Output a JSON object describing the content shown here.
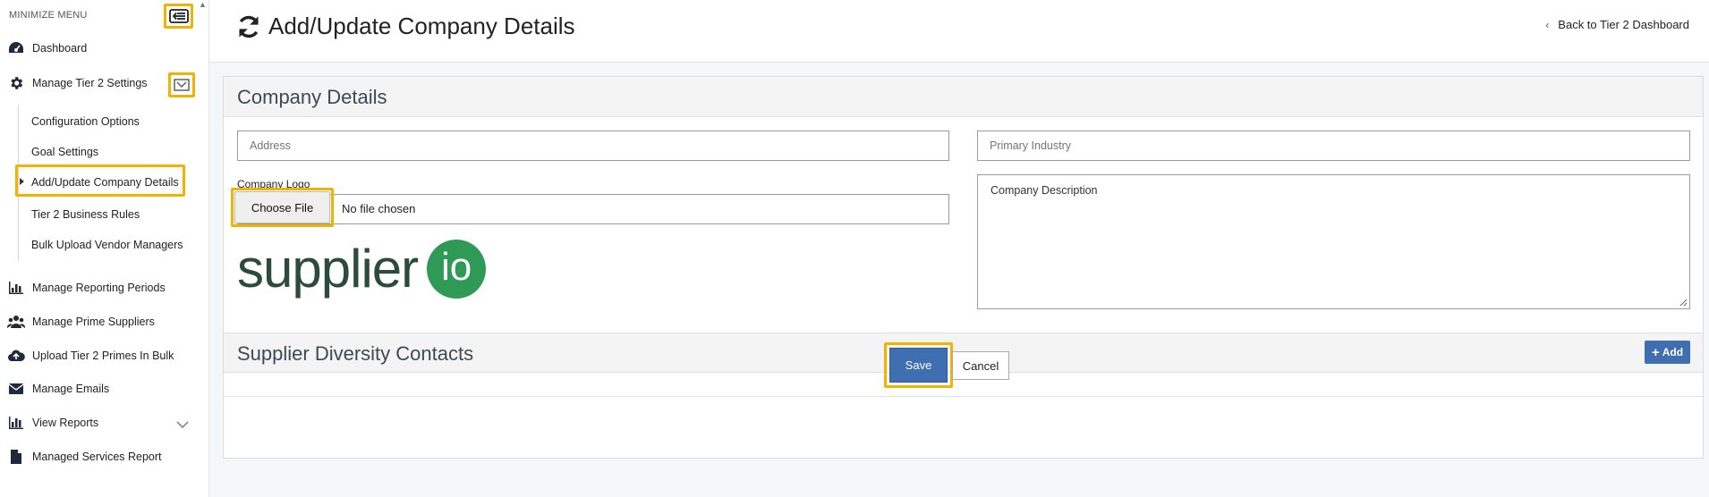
{
  "sidebar": {
    "minimize_label": "MINIMIZE MENU",
    "items": [
      {
        "label": "Dashboard",
        "icon": "dashboard-icon"
      },
      {
        "label": "Manage Tier 2 Settings",
        "icon": "gear-icon"
      },
      {
        "label": "Manage Reporting Periods",
        "icon": "bar-chart-icon"
      },
      {
        "label": "Manage Prime Suppliers",
        "icon": "users-icon"
      },
      {
        "label": "Upload Tier 2 Primes In Bulk",
        "icon": "cloud-upload-icon"
      },
      {
        "label": "Manage Emails",
        "icon": "envelope-icon"
      },
      {
        "label": "View Reports",
        "icon": "report-chart-icon"
      },
      {
        "label": "Managed Services Report",
        "icon": "file-icon"
      }
    ],
    "subitems": [
      {
        "label": "Configuration Options"
      },
      {
        "label": "Goal Settings"
      },
      {
        "label": "Add/Update Company Details"
      },
      {
        "label": "Tier 2 Business Rules"
      },
      {
        "label": "Bulk Upload Vendor Managers"
      }
    ]
  },
  "header": {
    "title": "Add/Update Company Details",
    "back_label": "Back to Tier 2 Dashboard"
  },
  "form": {
    "section_title": "Company Details",
    "address_placeholder": "Address",
    "industry_placeholder": "Primary Industry",
    "logo_label": "Company Logo",
    "choose_file_label": "Choose File",
    "no_file_text": "No file chosen",
    "description_placeholder": "Company Description",
    "logo": {
      "word": "supplier",
      "badge": "io",
      "color": "#2d4a3e",
      "badge_color": "#2e9a56"
    }
  },
  "contacts": {
    "section_title": "Supplier Diversity Contacts",
    "add_label": "Add"
  },
  "actions": {
    "save_label": "Save",
    "cancel_label": "Cancel"
  },
  "colors": {
    "accent": "#3f6fb0",
    "highlight": "#f0b400"
  }
}
